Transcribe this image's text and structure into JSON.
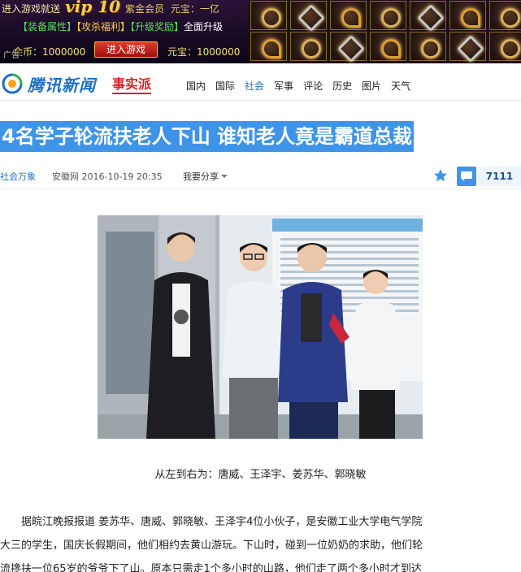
{
  "ad": {
    "top_line": "进入游戏就送",
    "vip_label": "vip 10",
    "member_label": "紫金会员",
    "yuanbao_top": "元宝：一亿",
    "tags": [
      "【装备属性】",
      "【攻杀福利】",
      "【升级奖励】",
      "全面升级"
    ],
    "gold_label": "金币：1000000",
    "enter_button": "进入游戏",
    "yuanbao_label": "元宝：1000000",
    "ad_tag": "广告"
  },
  "header": {
    "logo_text": "腾讯新闻",
    "logo_sub": "事实派",
    "nav": [
      {
        "label": "国内",
        "active": false
      },
      {
        "label": "国际",
        "active": false
      },
      {
        "label": "社会",
        "active": true
      },
      {
        "label": "军事",
        "active": false
      },
      {
        "label": "评论",
        "active": false
      },
      {
        "label": "历史",
        "active": false
      },
      {
        "label": "图片",
        "active": false
      },
      {
        "label": "天气",
        "active": false
      }
    ]
  },
  "article": {
    "title": "4名学子轮流扶老人下山 谁知老人竟是霸道总裁",
    "channel": "社会万象",
    "source_time": "安徽网 2016-10-19 20:35",
    "share_label": "我要分享",
    "comment_count": "7111",
    "photo_caption": "从左到右为：唐威、王泽宇、姜苏华、郭晓敏",
    "body_lines": [
      "据皖江晚报报道 姜苏华、唐威、郭晓敏、王泽宇4位小伙子，是安徽工业大学电气学院",
      "大三的学生，国庆长假期间，他们相约去黄山游玩。下山时，碰到一位奶奶的求助，他们轮",
      "流搀扶一位65岁的爷爷下了山。原本只需走1个多小时的山路，他们走了两个多小时才到达"
    ]
  },
  "colors": {
    "brand_blue": "#1b6fc6",
    "title_highlight": "#3f94e8",
    "brand_red": "#d12323"
  }
}
